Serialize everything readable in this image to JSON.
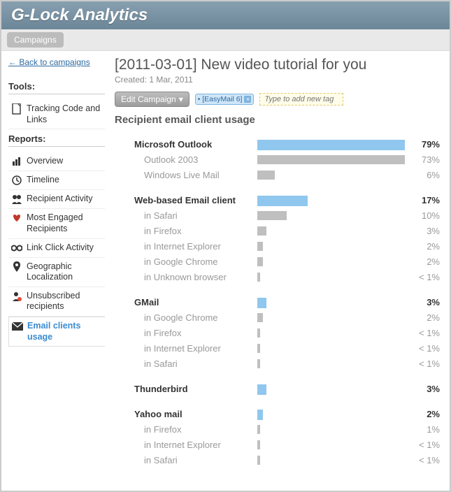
{
  "app_title": "G-Lock Analytics",
  "topnav": {
    "campaigns": "Campaigns"
  },
  "back_link": "← Back to campaigns",
  "sidebar": {
    "tools_header": "Tools:",
    "reports_header": "Reports:",
    "tools": [
      {
        "label": "Tracking Code and Links"
      }
    ],
    "reports": [
      {
        "label": "Overview"
      },
      {
        "label": "Timeline"
      },
      {
        "label": "Recipient Activity"
      },
      {
        "label": "Most Engaged Recipients"
      },
      {
        "label": "Link Click Activity"
      },
      {
        "label": "Geographic Localization"
      },
      {
        "label": "Unsubscribed recipients"
      },
      {
        "label": "Email clients usage"
      }
    ]
  },
  "campaign": {
    "title": "[2011-03-01] New video tutorial for you",
    "created": "Created: 1 Mar, 2011",
    "edit_button": "Edit Campaign",
    "tag": "[EasyMail 6]",
    "add_tag_placeholder": "Type to add new tag"
  },
  "subtitle": "Recipient email client usage",
  "chart_data": {
    "type": "bar",
    "xlabel": "",
    "ylabel": "",
    "groups": [
      {
        "name": "Microsoft Outlook",
        "pct": "79%",
        "w": 79,
        "children": [
          {
            "name": "Outlook 2003",
            "pct": "73%",
            "w": 73
          },
          {
            "name": "Windows Live Mail",
            "pct": "6%",
            "w": 6
          }
        ]
      },
      {
        "name": "Web-based Email client",
        "pct": "17%",
        "w": 17,
        "children": [
          {
            "name": "in Safari",
            "pct": "10%",
            "w": 10
          },
          {
            "name": "in Firefox",
            "pct": "3%",
            "w": 3
          },
          {
            "name": "in Internet Explorer",
            "pct": "2%",
            "w": 2
          },
          {
            "name": "in Google Chrome",
            "pct": "2%",
            "w": 2
          },
          {
            "name": "in Unknown browser",
            "pct": "< 1%",
            "w": 1
          }
        ]
      },
      {
        "name": "GMail",
        "pct": "3%",
        "w": 3,
        "children": [
          {
            "name": "in Google Chrome",
            "pct": "2%",
            "w": 2
          },
          {
            "name": "in Firefox",
            "pct": "< 1%",
            "w": 1
          },
          {
            "name": "in Internet Explorer",
            "pct": "< 1%",
            "w": 1
          },
          {
            "name": "in Safari",
            "pct": "< 1%",
            "w": 1
          }
        ]
      },
      {
        "name": "Thunderbird",
        "pct": "3%",
        "w": 3,
        "children": []
      },
      {
        "name": "Yahoo mail",
        "pct": "2%",
        "w": 2,
        "children": [
          {
            "name": "in Firefox",
            "pct": "1%",
            "w": 1
          },
          {
            "name": "in Internet Explorer",
            "pct": "< 1%",
            "w": 1
          },
          {
            "name": "in Safari",
            "pct": "< 1%",
            "w": 1
          }
        ]
      }
    ]
  }
}
